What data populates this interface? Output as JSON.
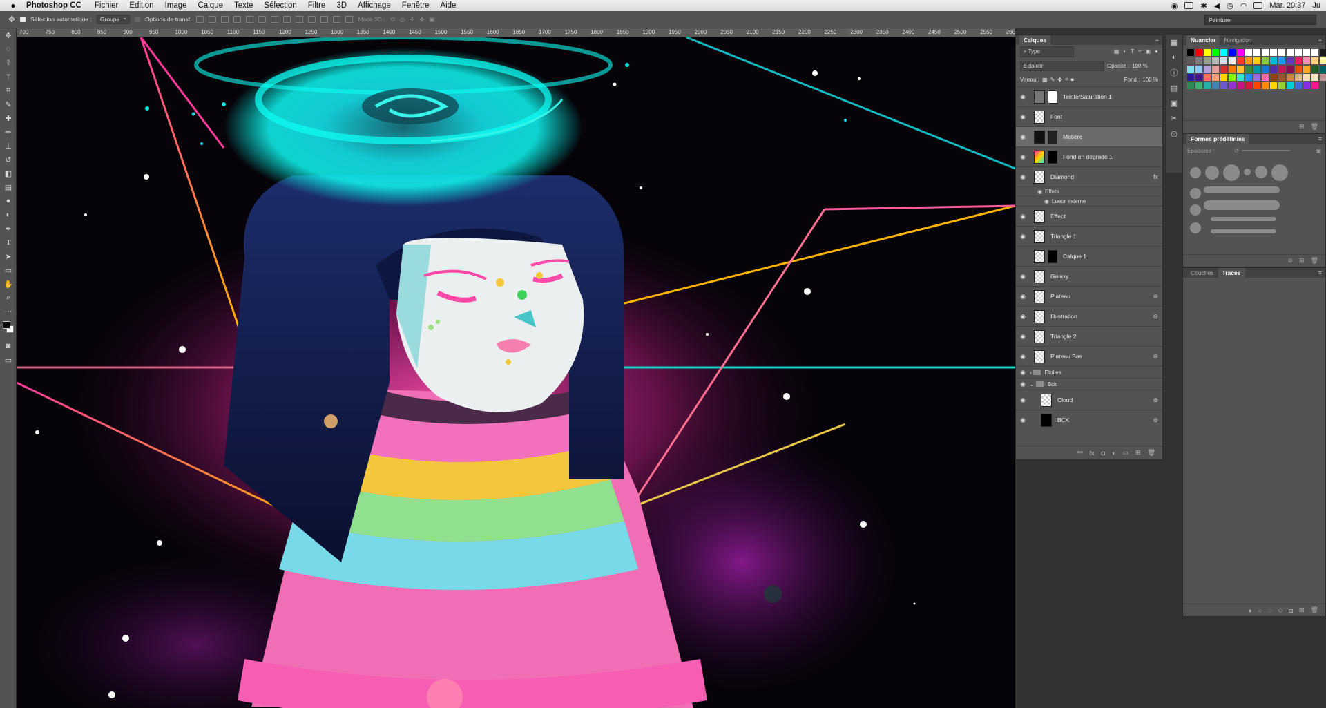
{
  "menubar": {
    "apple": "",
    "app_name": "Photoshop CC",
    "items": [
      "Fichier",
      "Edition",
      "Image",
      "Calque",
      "Texte",
      "Sélection",
      "Filtre",
      "3D",
      "Affichage",
      "Fenêtre",
      "Aide"
    ],
    "clock": "Mar. 20:37",
    "user": "Ju"
  },
  "options": {
    "auto_select_label": "Sélection automatique :",
    "auto_select_value": "Groupe",
    "transform_label": "Options de transf.",
    "mode3d_label": "Mode 3D :"
  },
  "workspace": {
    "value": "Peinture"
  },
  "ruler": {
    "ticks": [
      "700",
      "750",
      "800",
      "850",
      "900",
      "950",
      "1000",
      "1050",
      "1100",
      "1150",
      "1200",
      "1250",
      "1300",
      "1350",
      "1400",
      "1450",
      "1500",
      "1550",
      "1600",
      "1650",
      "1700",
      "1750",
      "1800",
      "1850",
      "1900",
      "1950",
      "2000",
      "2050",
      "2100",
      "2150",
      "2200",
      "2250",
      "2300",
      "2350",
      "2400",
      "2450",
      "2500",
      "2550",
      "2600"
    ]
  },
  "calques": {
    "title": "Calques",
    "filter": "Type",
    "blend": "Eclaircir",
    "opacity_label": "Opacité :",
    "opacity": "100 %",
    "lock_label": "Verrou :",
    "fill_label": "Fond :",
    "fill": "100 %",
    "layers": [
      {
        "name": "Teinte/Saturation 1",
        "visible": true,
        "active": false
      },
      {
        "name": "Font",
        "visible": true,
        "active": false
      },
      {
        "name": "Matière",
        "visible": true,
        "active": true
      },
      {
        "name": "Fond en dégradé 1",
        "visible": true,
        "active": false
      },
      {
        "name": "Diamond",
        "visible": true,
        "active": false,
        "fx": "fx"
      },
      {
        "name": "Effect",
        "visible": true,
        "active": false
      },
      {
        "name": "Triangle 1",
        "visible": true,
        "active": false
      },
      {
        "name": "Calque 1",
        "visible": false,
        "active": false
      },
      {
        "name": "Galaxy",
        "visible": true,
        "active": false
      },
      {
        "name": "Plateau",
        "visible": true,
        "active": false
      },
      {
        "name": "Illustration",
        "visible": true,
        "active": false
      },
      {
        "name": "Triangle 2",
        "visible": true,
        "active": false
      },
      {
        "name": "Plateau Bas",
        "visible": true,
        "active": false
      }
    ],
    "effects_label": "Effets",
    "effect_item": "Lueur externe",
    "groups": [
      "Etoiles",
      "Bck"
    ],
    "group_layers": [
      "Cloud",
      "BCK"
    ],
    "footer_fx": "fx"
  },
  "nuancier": {
    "tabs": [
      "Nuancier",
      "Navigation"
    ],
    "colors": [
      "#000000",
      "#ff0000",
      "#ffff00",
      "#00ff00",
      "#00ffff",
      "#0000ff",
      "#ff00ff",
      "#ffffff",
      "#ffffff",
      "#ffffff",
      "#ffffff",
      "#ffffff",
      "#ffffff",
      "#ffffff",
      "#ffffff",
      "#ffffff",
      "#1a1a1a",
      "#3a3a3a",
      "#5a5a5a",
      "#7a7a7a",
      "#9a9a9a",
      "#bababa",
      "#dadada",
      "#eeeeee",
      "#ff3b30",
      "#ff9500",
      "#ffcc00",
      "#8bc34a",
      "#00bcd4",
      "#2196f3",
      "#673ab7",
      "#e91e63",
      "#f48fb1",
      "#ffcc80",
      "#fff59d",
      "#c5e1a5",
      "#80deea",
      "#90caf9",
      "#b39ddb",
      "#ef9a9a",
      "#d32f2f",
      "#f57c00",
      "#fbc02d",
      "#388e3c",
      "#0097a7",
      "#1976d2",
      "#512da8",
      "#c2185b",
      "#880e4f",
      "#e65100",
      "#f9a825",
      "#1b5e20",
      "#006064",
      "#0d47a1",
      "#311b92",
      "#4a148c",
      "#ff6f61",
      "#ffa07a",
      "#ffd700",
      "#7fff00",
      "#40e0d0",
      "#1e90ff",
      "#9370db",
      "#ff69b4",
      "#8b4513",
      "#a0522d",
      "#cd853f",
      "#deb887",
      "#f5deb3",
      "#ffe4c4",
      "#bc8f8f",
      "#696969",
      "#2e8b57",
      "#3cb371",
      "#20b2aa",
      "#4682b4",
      "#6a5acd",
      "#9932cc",
      "#c71585",
      "#dc143c",
      "#ff4500",
      "#ff8c00",
      "#ffd700",
      "#9acd32",
      "#00ced1",
      "#4169e1",
      "#8a2be2",
      "#ff1493"
    ]
  },
  "formes": {
    "title": "Formes prédéfinies",
    "thickness_label": "Épaisseur :"
  },
  "couches": {
    "tabs": [
      "Couches",
      "Tracés"
    ]
  }
}
